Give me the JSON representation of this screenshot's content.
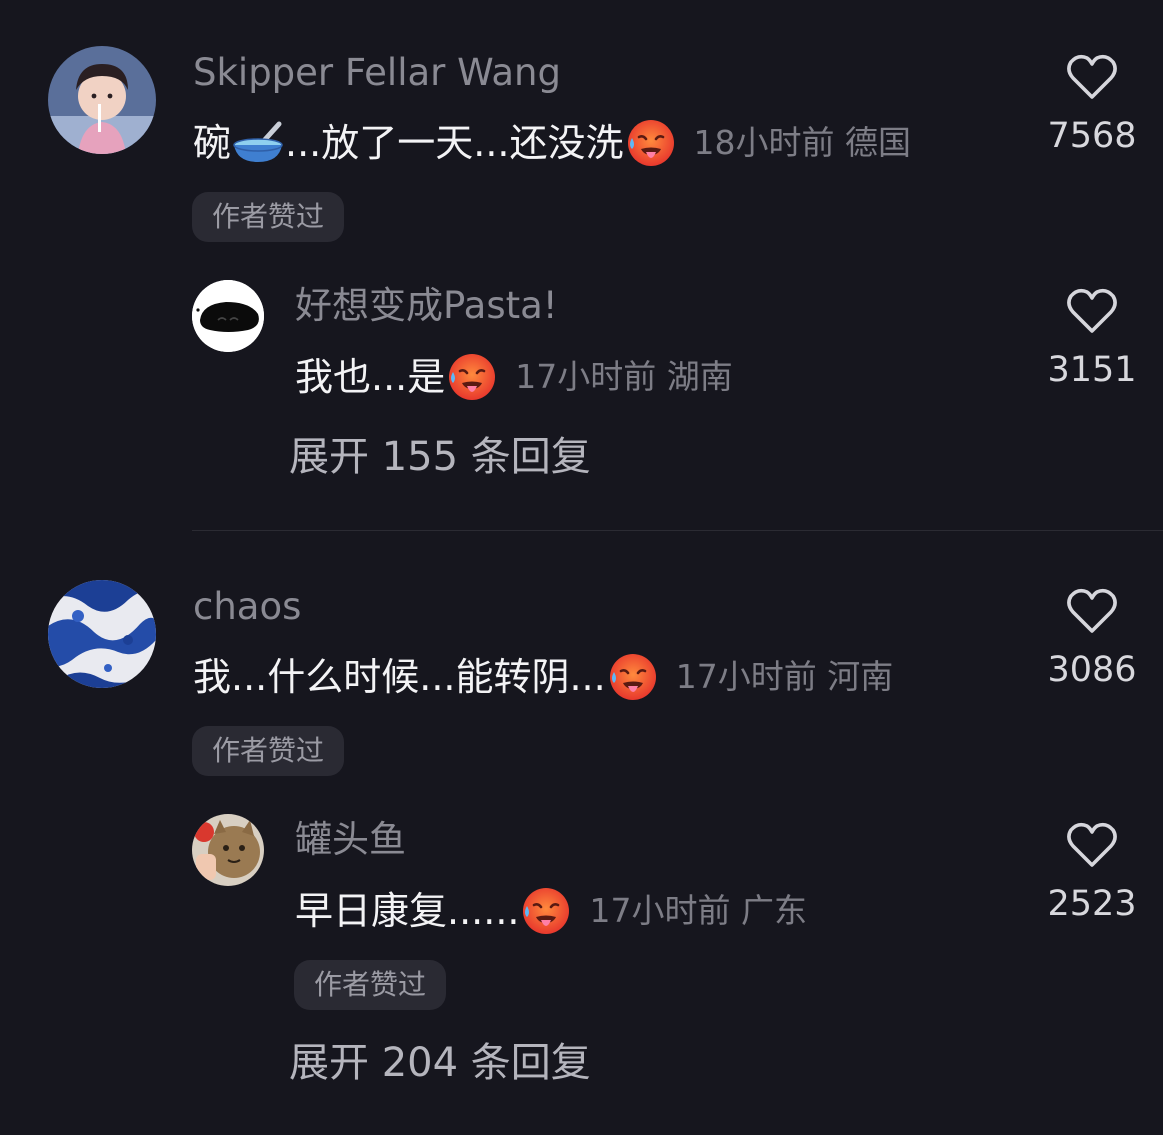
{
  "colors": {
    "background": "#16161e",
    "username": "#8a8a93",
    "text": "#f3f3f5",
    "meta": "#7d7d86",
    "badge_bg": "#2a2a33"
  },
  "comments": [
    {
      "username": "Skipper Fellar Wang",
      "text_before": "碗",
      "inline_emoji": "bowl-with-spoon-emoji",
      "text_after": "...放了一天...还没洗",
      "trailing_emoji": "hot-face-emoji",
      "meta": "18小时前 德国",
      "badge": "作者赞过",
      "likes": "7568",
      "reply": {
        "username": "好想变成Pasta!",
        "text": "我也...是",
        "trailing_emoji": "hot-face-emoji",
        "meta": "17小时前 湖南",
        "likes": "3151"
      },
      "expand": "展开 155 条回复"
    },
    {
      "username": "chaos",
      "text": "我...什么时候...能转阴...",
      "trailing_emoji": "hot-face-emoji",
      "meta": "17小时前 河南",
      "badge": "作者赞过",
      "likes": "3086",
      "reply": {
        "username": "罐头鱼",
        "text": "早日康复......",
        "trailing_emoji": "hot-face-emoji",
        "meta": "17小时前 广东",
        "badge": "作者赞过",
        "likes": "2523"
      },
      "expand": "展开 204 条回复"
    }
  ]
}
